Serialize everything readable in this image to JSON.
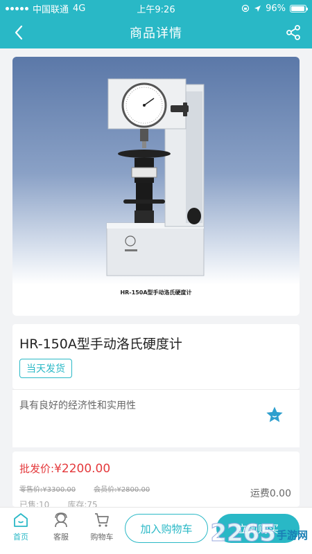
{
  "status_bar": {
    "carrier": "中国联通",
    "network": "4G",
    "time": "上午9:26",
    "battery": "96%"
  },
  "header": {
    "title": "商品详情",
    "back_icon": "back-arrow-icon",
    "share_icon": "share-icon"
  },
  "product": {
    "image_caption": "HR-150A型手动洛氏硬度计",
    "title": "HR-150A型手动洛氏硬度计",
    "tag": "当天发货",
    "description": "具有良好的经济性和实用性"
  },
  "price": {
    "wholesale_label": "批发价:",
    "wholesale_value": "¥2200.00",
    "retail": "零售价:¥3300.00",
    "member": "会员价:¥2800.00",
    "shipping": "运费0.00",
    "sold": "已售:10",
    "stock": "库存:75"
  },
  "bottom_nav": {
    "home": "首页",
    "service": "客服",
    "cart": "购物车",
    "add_to_cart": "加入购物车",
    "buy_now": "立即购买"
  },
  "watermark": {
    "text": "2265",
    "sub": "手游网"
  },
  "colors": {
    "accent": "#29b8c6",
    "price": "#e4393c"
  }
}
